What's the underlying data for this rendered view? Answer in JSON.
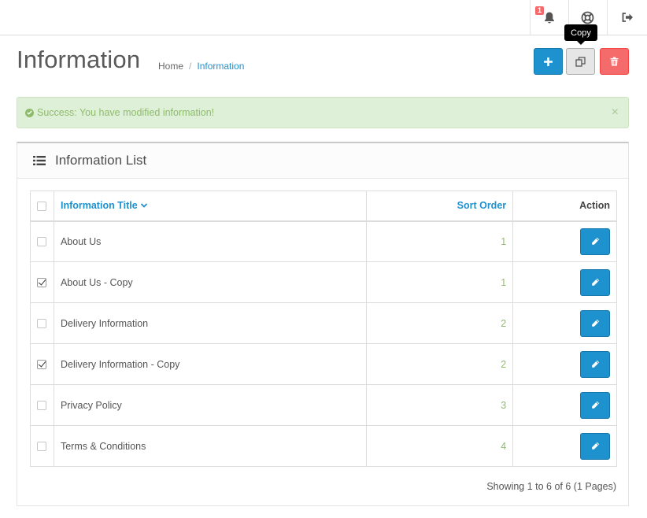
{
  "topbar": {
    "notification_count": "1",
    "icons": [
      "bell-icon",
      "lifebuoy-icon",
      "sign-out-icon"
    ]
  },
  "header": {
    "title": "Information",
    "breadcrumb": [
      {
        "label": "Home"
      },
      {
        "label": "Information"
      }
    ],
    "tooltip": "Copy",
    "buttons": {
      "add_icon": "plus-icon",
      "copy_icon": "copy-icon",
      "delete_icon": "trash-icon"
    }
  },
  "alert": {
    "message": "Success: You have modified information!",
    "close": "×"
  },
  "panel": {
    "title": "Information List",
    "columns": {
      "title": "Information Title",
      "sort_order": "Sort Order",
      "action": "Action"
    },
    "rows": [
      {
        "title": "About Us",
        "sort_order": "1",
        "checked": false
      },
      {
        "title": "About Us - Copy",
        "sort_order": "1",
        "checked": true
      },
      {
        "title": "Delivery Information",
        "sort_order": "2",
        "checked": false
      },
      {
        "title": "Delivery Information - Copy",
        "sort_order": "2",
        "checked": true
      },
      {
        "title": "Privacy Policy",
        "sort_order": "3",
        "checked": false
      },
      {
        "title": "Terms & Conditions",
        "sort_order": "4",
        "checked": false
      }
    ],
    "pagination": "Showing 1 to 6 of 6 (1 Pages)"
  },
  "colors": {
    "primary": "#1e91cf",
    "danger": "#f56b6b",
    "success_text": "#8fbb6c",
    "success_bg": "#dff0d8"
  }
}
